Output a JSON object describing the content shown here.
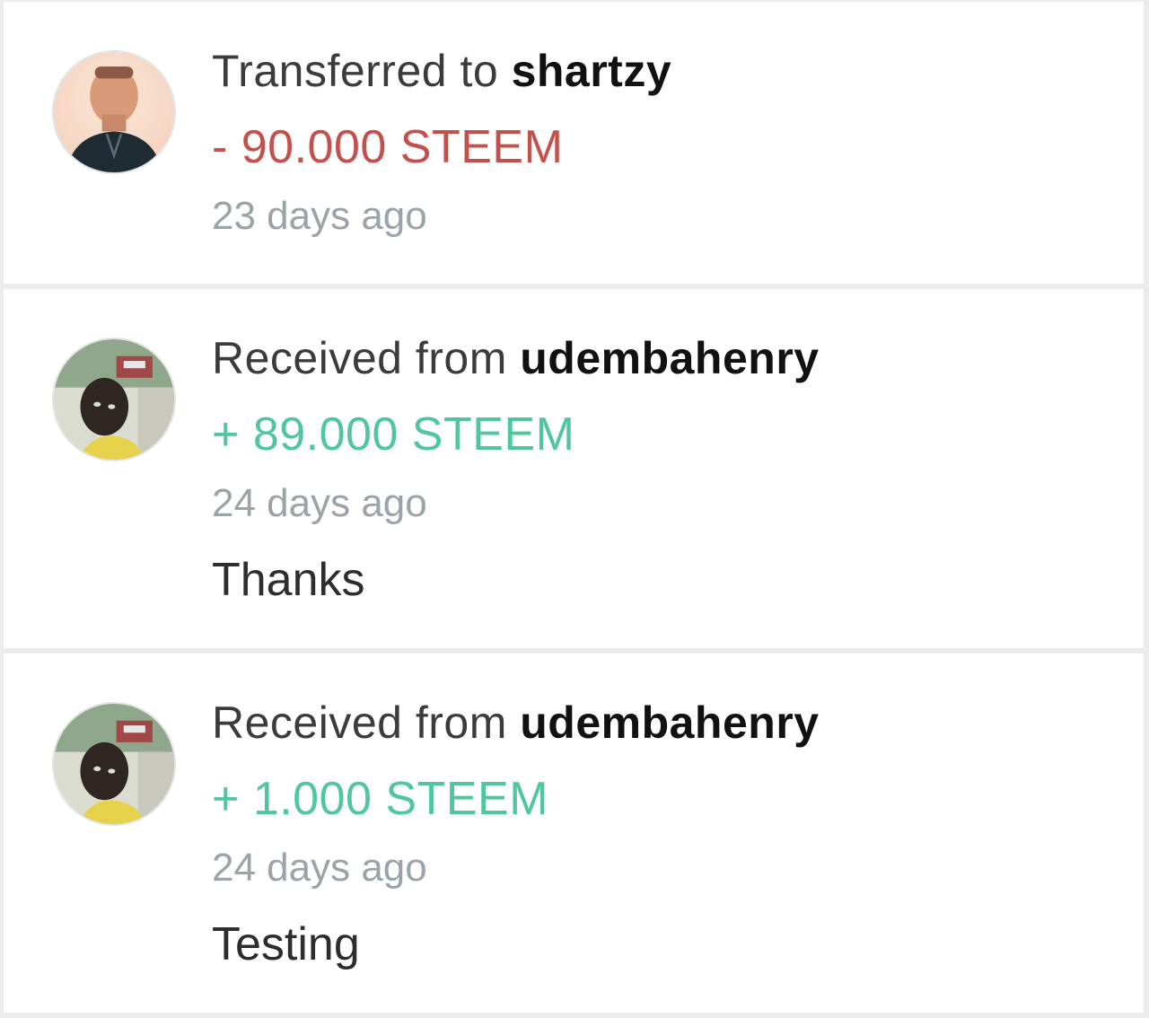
{
  "transactions": [
    {
      "prefix": "Transferred to ",
      "user": "shartzy",
      "amount": "- 90.000 STEEM",
      "direction": "out",
      "time": "23 days ago",
      "memo": ""
    },
    {
      "prefix": "Received from ",
      "user": "udembahenry",
      "amount": "+ 89.000 STEEM",
      "direction": "in",
      "time": "24 days ago",
      "memo": "Thanks"
    },
    {
      "prefix": "Received from ",
      "user": "udembahenry",
      "amount": "+ 1.000 STEEM",
      "direction": "in",
      "time": "24 days ago",
      "memo": "Testing"
    }
  ],
  "colors": {
    "negative": "#c4504c",
    "positive": "#4fc6a0",
    "muted": "#9aa3a8",
    "background": "#ececec"
  }
}
